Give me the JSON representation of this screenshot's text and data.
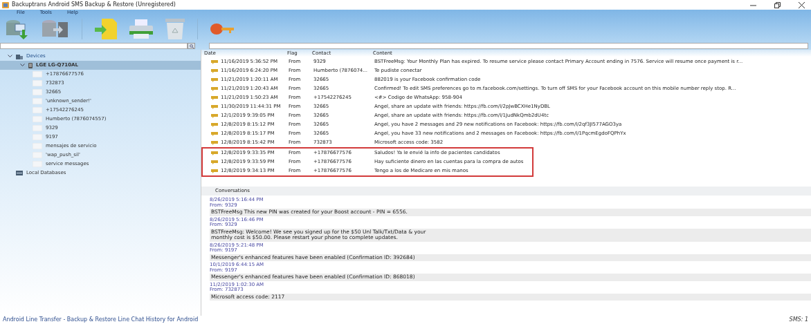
{
  "window": {
    "title": "Backuptrans Android SMS Backup & Restore (Unregistered)"
  },
  "menu": [
    "File",
    "Tools",
    "Help"
  ],
  "toolbar": [
    {
      "kind": "db-import"
    },
    {
      "kind": "db-transfer"
    },
    {
      "kind": "separator"
    },
    {
      "kind": "export"
    },
    {
      "kind": "print"
    },
    {
      "kind": "trash"
    },
    {
      "kind": "separator"
    },
    {
      "kind": "key"
    }
  ],
  "tree": [
    {
      "label": "Devices",
      "kind": "devices",
      "expanded": true,
      "selected": false,
      "children": [
        {
          "label": "LGE LG-Q710AL",
          "kind": "phone",
          "expanded": true,
          "selected": true,
          "children": [
            {
              "label": "+17876677576",
              "kind": "contact",
              "selected": false
            },
            {
              "label": "732873",
              "kind": "contact",
              "selected": false
            },
            {
              "label": "32665",
              "kind": "contact",
              "selected": false
            },
            {
              "label": "'unknown_sender!'",
              "kind": "contact",
              "selected": false
            },
            {
              "label": "+17542276245",
              "kind": "contact",
              "selected": false
            },
            {
              "label": "Humberto (7876074557)",
              "kind": "contact",
              "selected": false
            },
            {
              "label": "9329",
              "kind": "contact",
              "selected": false
            },
            {
              "label": "9197",
              "kind": "contact",
              "selected": false
            },
            {
              "label": "mensajes de servicio",
              "kind": "contact",
              "selected": false
            },
            {
              "label": "'wap_push_sil'",
              "kind": "contact",
              "selected": false
            },
            {
              "label": "service messages",
              "kind": "contact",
              "selected": false
            }
          ]
        }
      ]
    },
    {
      "label": "Local Databases",
      "kind": "databases",
      "selected": false
    }
  ],
  "table": {
    "columns": [
      "Date",
      "Flag",
      "Contact",
      "Content"
    ],
    "rows": [
      {
        "date": "11/16/2019 5:36:52 PM",
        "flag": "From",
        "contact": "9329",
        "content": "BSTFreeMsg: Your Monthly Plan has expired. To resume service please contact Primary Account ending in 7576. Service will resume once payment is r...",
        "highlighted": false
      },
      {
        "date": "11/16/2019 6:24:20 PM",
        "flag": "From",
        "contact": "Humberto (7876074...",
        "content": "Te pudiste conectar",
        "highlighted": false
      },
      {
        "date": "11/21/2019 1:20:11 AM",
        "flag": "From",
        "contact": "32665",
        "content": "882019 is your Facebook confirmation code",
        "highlighted": false
      },
      {
        "date": "11/21/2019 1:20:43 AM",
        "flag": "From",
        "contact": "32665",
        "content": "Confirmed! To edit SMS preferences go to m.facebook.com/settings. To turn off SMS for your Facebook account on this mobile number reply stop. R...",
        "highlighted": false
      },
      {
        "date": "11/21/2019 1:50:23 AM",
        "flag": "From",
        "contact": "+17542276245",
        "content": "<#> Codigo de WhatsApp: 958-904",
        "highlighted": false
      },
      {
        "date": "11/30/2019 11:44:31 PM",
        "flag": "From",
        "contact": "32665",
        "content": "Angel, share an update with friends: https://fb.com/l/2pJwBCXHe1NyDBL",
        "highlighted": false
      },
      {
        "date": "12/1/2019 9:39:05 PM",
        "flag": "From",
        "contact": "32665",
        "content": "Angel, share an update with friends: https://fb.com/l/1JudNkQmb2dU4tc",
        "highlighted": false
      },
      {
        "date": "12/8/2019 8:15:12 PM",
        "flag": "From",
        "contact": "32665",
        "content": "Angel, you have 2 messages and 29 new notifications on Facebook: https://fb.com/l/2qf3JI577AGO3ya",
        "highlighted": false
      },
      {
        "date": "12/8/2019 8:15:17 PM",
        "flag": "From",
        "contact": "32665",
        "content": "Angel, you have 33 new notifications and 2 messages on Facebook: https://fb.com/l/1PqcmEgdoFQPhYx",
        "highlighted": false
      },
      {
        "date": "12/8/2019 8:15:42 PM",
        "flag": "From",
        "contact": "732873",
        "content": "Microsoft access code: 3582",
        "highlighted": false
      },
      {
        "date": "12/8/2019 9:33:35 PM",
        "flag": "From",
        "contact": "+17876677576",
        "content": "Saludos! Ya le envié la info de pacientes candidatos",
        "highlighted": true
      },
      {
        "date": "12/8/2019 9:33:59 PM",
        "flag": "From",
        "contact": "+17876677576",
        "content": "Hay suficiente dinero en las cuentas para la compra de autos",
        "highlighted": true
      },
      {
        "date": "12/8/2019 9:34:13 PM",
        "flag": "From",
        "contact": "+17876677576",
        "content": "Tengo a los de Medicare en mis manos",
        "highlighted": true
      }
    ]
  },
  "conversations": {
    "title": "Conversations",
    "messages": [
      {
        "time": "8/26/2019 5:16:44 PM",
        "from": "From: 9329",
        "body": "BSTFreeMsg This new PIN was created for your Boost account - PIN = 6556."
      },
      {
        "time": "8/26/2019 5:16:46 PM",
        "from": "From: 9329",
        "body": "BSTFreeMsg: Welcome! We see you signed up for the $50 Unl Talk/Txt/Data & your\nmonthly cost is $50.00. Please restart your phone to complete updates."
      },
      {
        "time": "8/26/2019 5:21:48 PM",
        "from": "From: 9197",
        "body": "Messenger's enhanced features have been enabled (Confirmation ID: 392684)"
      },
      {
        "time": "10/1/2019 6:44:15 AM",
        "from": "From: 9197",
        "body": "Messenger's enhanced features have been enabled (Confirmation ID: 868018)"
      },
      {
        "time": "11/2/2019 1:02:30 AM",
        "from": "From: 732873",
        "body": "Microsoft access code: 2117"
      }
    ]
  },
  "status_bar": {
    "text": "Android Line Transfer - Backup & Restore Line Chat History for Android",
    "count": "SMS: 1"
  }
}
